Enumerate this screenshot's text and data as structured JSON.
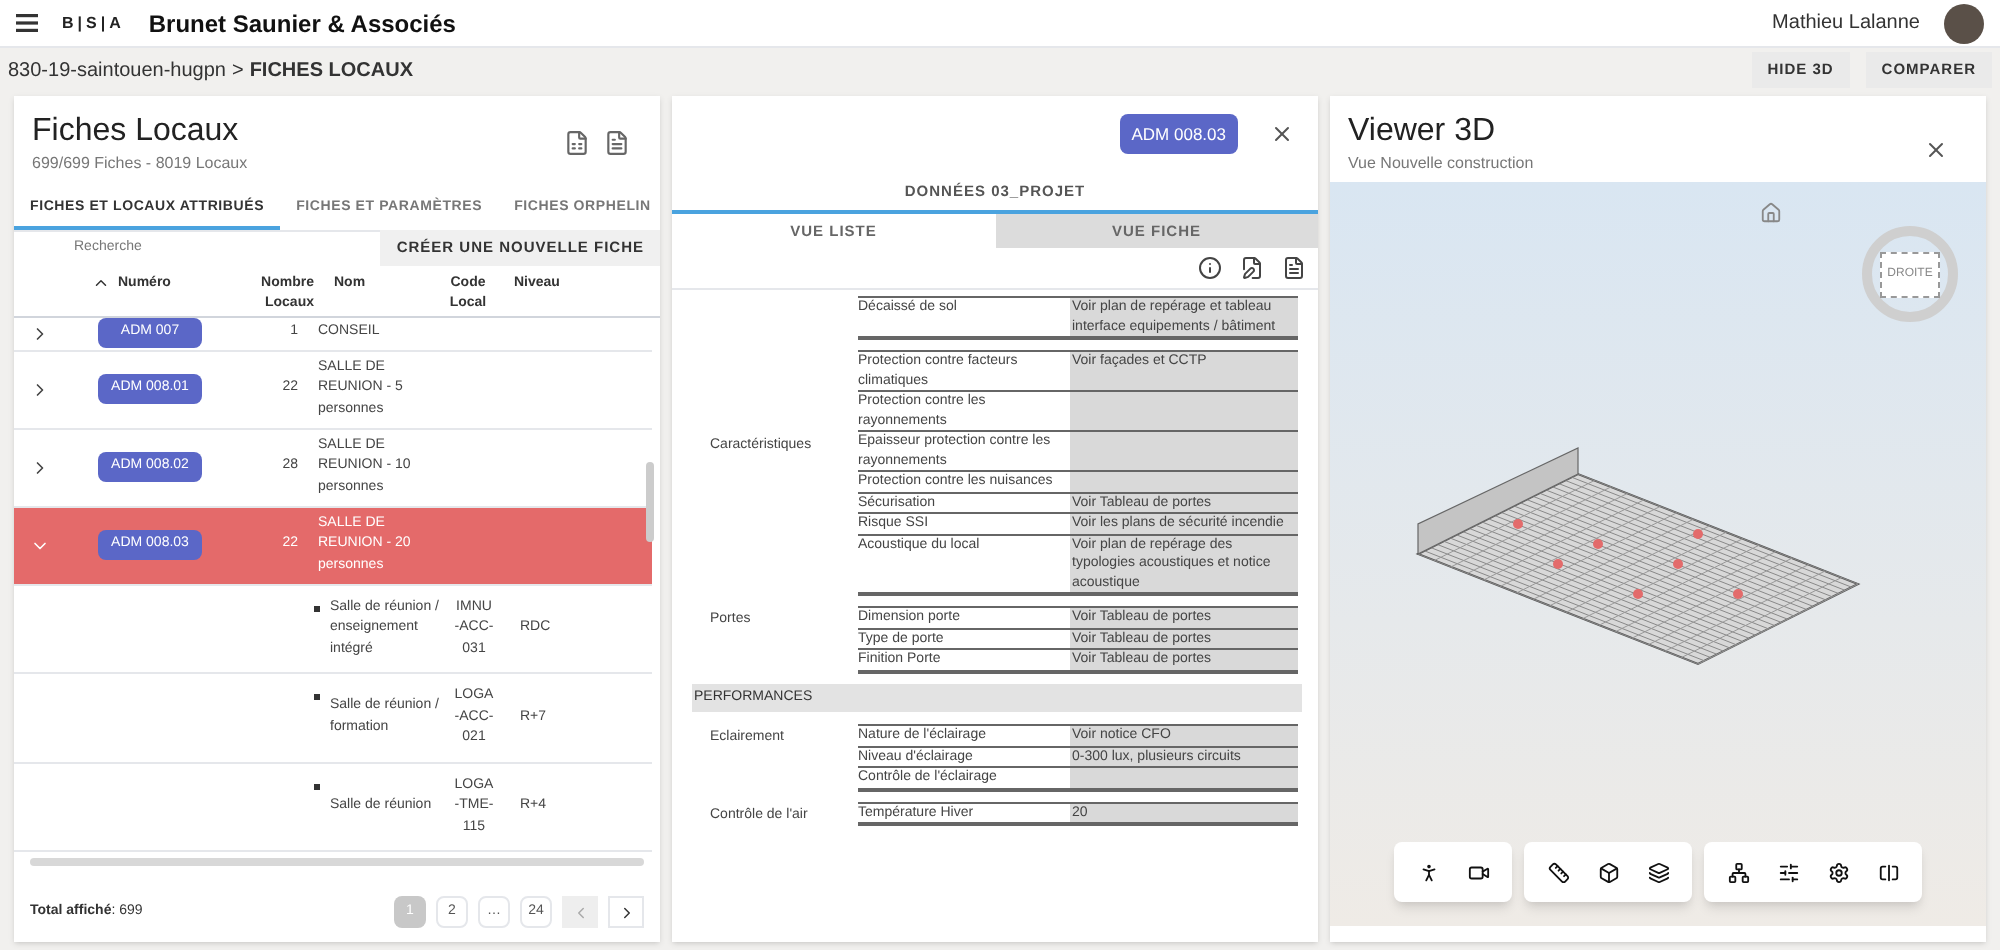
{
  "header": {
    "logo": "B|S|A",
    "company": "Brunet Saunier & Associés",
    "user": "Mathieu Lalanne"
  },
  "breadcrumb": {
    "path": "830-19-saintouen-hugpn",
    "separator": ">",
    "current": "FICHES LOCAUX"
  },
  "top_actions": [
    "HIDE 3D",
    "COMPARER"
  ],
  "fiches": {
    "title": "Fiches Locaux",
    "subtitle": "699/699 Fiches - 8019 Locaux",
    "tabs": [
      {
        "label": "FICHES ET LOCAUX ATTRIBUÉS",
        "selected": true
      },
      {
        "label": "FICHES ET PARAMÈTRES",
        "selected": false
      },
      {
        "label": "FICHES ORPHELIN",
        "selected": false
      }
    ],
    "search": {
      "placeholder": "Recherche"
    },
    "create_button": "CRÉER UNE NOUVELLE FICHE",
    "columns": [
      "Numéro",
      "Nombre Locaux",
      "Nom",
      "Code Local",
      "Niveau"
    ],
    "rows": [
      {
        "kind": "group",
        "numero": "ADM 007",
        "count": "1",
        "nom": "CONSEIL",
        "expanded": false,
        "selected": false
      },
      {
        "kind": "group",
        "numero": "ADM 008.01",
        "count": "22",
        "nom": "SALLE DE REUNION - 5 personnes",
        "expanded": false,
        "selected": false
      },
      {
        "kind": "group",
        "numero": "ADM 008.02",
        "count": "28",
        "nom": "SALLE DE REUNION - 10 personnes",
        "expanded": false,
        "selected": false
      },
      {
        "kind": "group",
        "numero": "ADM 008.03",
        "count": "22",
        "nom": "SALLE DE REUNION - 20 personnes",
        "expanded": true,
        "selected": true
      },
      {
        "kind": "child",
        "nom": "Salle de réunion / enseignement intégré",
        "code": "IMNU-ACC-031",
        "niveau": "RDC"
      },
      {
        "kind": "child",
        "nom": "Salle de réunion / formation",
        "code": "LOGA-ACC-021",
        "niveau": "R+7"
      },
      {
        "kind": "child",
        "nom": "Salle de réunion",
        "code": "LOGA-TME-115",
        "niveau": "R+4"
      }
    ],
    "total_label": "Total affiché",
    "total_separator": ":",
    "total": "699",
    "pages": [
      {
        "label": "1",
        "selected": true
      },
      {
        "label": "2",
        "selected": false
      },
      {
        "label": "…",
        "selected": false
      },
      {
        "label": "24",
        "selected": false
      }
    ],
    "prev_disabled": true
  },
  "detail": {
    "badge": "ADM 008.03",
    "section_title": "DONNÉES 03_PROJET",
    "tabs": [
      {
        "label": "VUE LISTE",
        "selected": true
      },
      {
        "label": "VUE FICHE",
        "selected": false
      }
    ],
    "sections": [
      {
        "kind": "group",
        "items": [
          {
            "label": "Décaissé de sol",
            "value": "Voir plan de repérage et tableau interface equipements / bâtiment"
          }
        ]
      },
      {
        "kind": "group",
        "category": "Caractéristiques",
        "items": [
          {
            "label": "Protection contre facteurs climatiques",
            "value": "Voir façades et CCTP"
          },
          {
            "label": "Protection contre les rayonnements"
          },
          {
            "label": "Epaisseur protection contre les rayonnements"
          },
          {
            "label": "Protection contre les nuisances"
          },
          {
            "label": "Sécurisation",
            "value": "Voir Tableau de portes"
          },
          {
            "label": "Risque SSI",
            "value": "Voir les plans de sécurité incendie"
          },
          {
            "label": "Acoustique du local",
            "value": "Voir plan de repérage des typologies acoustiques et notice acoustique"
          }
        ]
      },
      {
        "kind": "group",
        "category": "Portes",
        "items": [
          {
            "label": "Dimension porte",
            "value": "Voir Tableau de portes"
          },
          {
            "label": "Type de porte",
            "value": "Voir Tableau de portes"
          },
          {
            "label": "Finition Porte",
            "value": "Voir Tableau de portes"
          }
        ]
      },
      {
        "kind": "heading",
        "label": "PERFORMANCES"
      },
      {
        "kind": "group",
        "category": "Eclairement",
        "items": [
          {
            "label": "Nature de l'éclairage",
            "value": "Voir notice CFO"
          },
          {
            "label": "Niveau d'éclairage",
            "value": "0-300 lux, plusieurs circuits"
          },
          {
            "label": "Contrôle de l'éclairage"
          }
        ]
      },
      {
        "kind": "group",
        "category": "Contrôle de l'air",
        "items": [
          {
            "label": "Température Hiver",
            "value": "20"
          }
        ]
      }
    ]
  },
  "viewer": {
    "title": "Viewer 3D",
    "subtitle": "Vue Nouvelle construction",
    "viewcube_label": "DROITE"
  }
}
